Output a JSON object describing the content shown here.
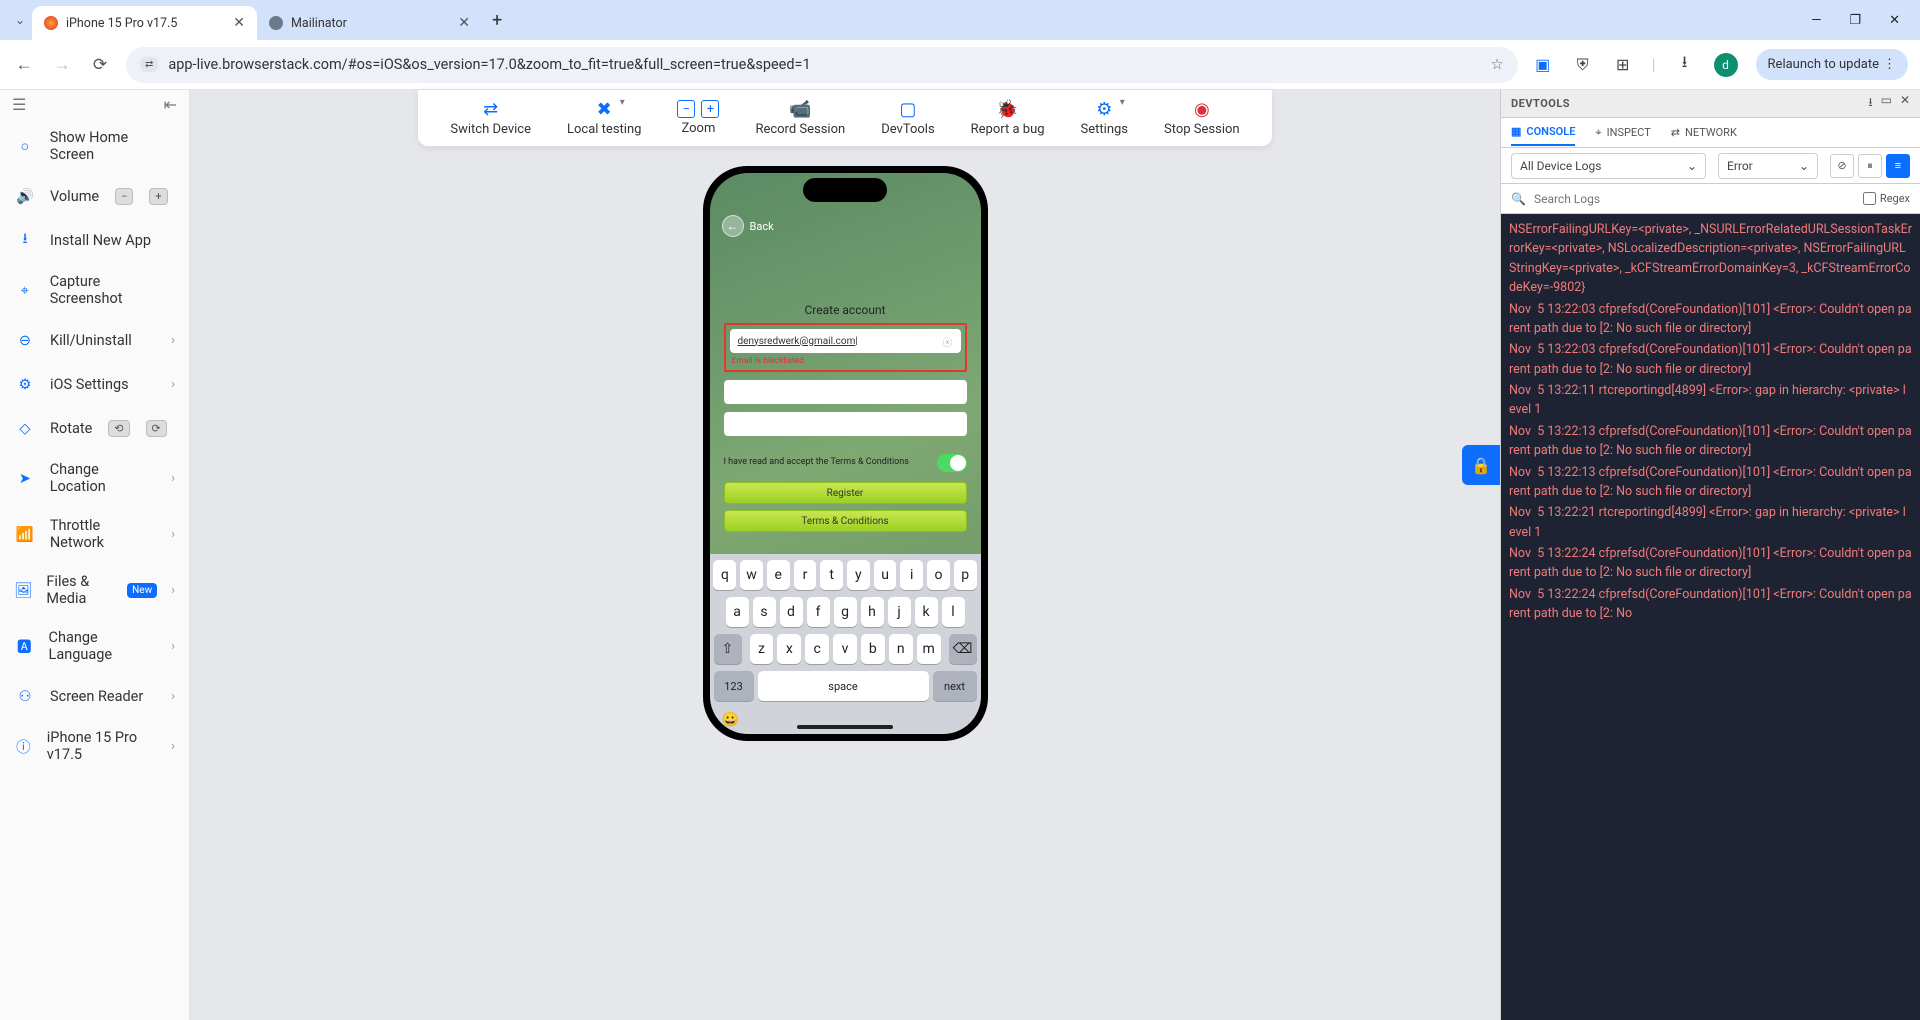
{
  "browser": {
    "tabs": [
      {
        "title": "iPhone 15 Pro v17.5",
        "active": true
      },
      {
        "title": "Mailinator",
        "active": false
      }
    ],
    "url": "app-live.browserstack.com/#os=iOS&os_version=17.0&zoom_to_fit=true&full_screen=true&speed=1",
    "avatar_initial": "d",
    "relaunch_label": "Relaunch to update"
  },
  "sidebar": {
    "items": [
      {
        "label": "Show Home Screen"
      },
      {
        "label": "Volume",
        "pills": [
          "−",
          "+"
        ]
      },
      {
        "label": "Install New App"
      },
      {
        "label": "Capture Screenshot"
      },
      {
        "label": "Kill/Uninstall",
        "chevron": true
      },
      {
        "label": "iOS Settings",
        "chevron": true
      },
      {
        "label": "Rotate",
        "pills": [
          "⟲",
          "⟳"
        ]
      },
      {
        "label": "Change Location",
        "chevron": true
      },
      {
        "label": "Throttle Network",
        "chevron": true
      },
      {
        "label": "Files & Media",
        "new": true,
        "chevron": true
      },
      {
        "label": "Change Language",
        "chevron": true
      },
      {
        "label": "Screen Reader",
        "chevron": true
      },
      {
        "label": "iPhone 15 Pro  v17.5",
        "chevron": true
      }
    ]
  },
  "toolbar": {
    "items": [
      {
        "label": "Switch Device"
      },
      {
        "label": "Local testing",
        "dropdown": true
      },
      {
        "label": "Zoom",
        "zoom": true
      },
      {
        "label": "Record Session"
      },
      {
        "label": "DevTools"
      },
      {
        "label": "Report a bug"
      },
      {
        "label": "Settings",
        "dropdown": true
      },
      {
        "label": "Stop Session",
        "stop": true
      }
    ]
  },
  "phone": {
    "back_label": "Back",
    "form_title": "Create account",
    "email_value": "denysredwerk@gmail.com",
    "email_error": "Email is blacklisted",
    "terms_text": "I have read and accept the Terms & Conditions",
    "register_label": "Register",
    "terms_btn_label": "Terms & Conditions",
    "keyboard": {
      "row1": [
        "q",
        "w",
        "e",
        "r",
        "t",
        "y",
        "u",
        "i",
        "o",
        "p"
      ],
      "row2": [
        "a",
        "s",
        "d",
        "f",
        "g",
        "h",
        "j",
        "k",
        "l"
      ],
      "row3": [
        "z",
        "x",
        "c",
        "v",
        "b",
        "n",
        "m"
      ],
      "num_label": "123",
      "space_label": "space",
      "next_label": "next"
    }
  },
  "devtools": {
    "title": "DEVTOOLS",
    "tabs": {
      "console": "CONSOLE",
      "inspect": "INSPECT",
      "network": "NETWORK"
    },
    "filter_device": "All Device Logs",
    "filter_level": "Error",
    "search_placeholder": "Search Logs",
    "regex_label": "Regex",
    "logs": [
      "NSErrorFailingURLKey=<private>, _NSURLErrorRelatedURLSessionTaskErrorKey=<private>, NSLocalizedDescription=<private>, NSErrorFailingURLStringKey=<private>, _kCFStreamErrorDomainKey=3, _kCFStreamErrorCodeKey=-9802}",
      "Nov  5 13:22:03 cfprefsd(CoreFoundation)[101] <Error>: Couldn't open parent path due to [2: No such file or directory]",
      "Nov  5 13:22:03 cfprefsd(CoreFoundation)[101] <Error>: Couldn't open parent path due to [2: No such file or directory]",
      "Nov  5 13:22:11 rtcreportingd[4899] <Error>: gap in hierarchy: <private> level 1",
      "Nov  5 13:22:13 cfprefsd(CoreFoundation)[101] <Error>: Couldn't open parent path due to [2: No such file or directory]",
      "Nov  5 13:22:13 cfprefsd(CoreFoundation)[101] <Error>: Couldn't open parent path due to [2: No such file or directory]",
      "Nov  5 13:22:21 rtcreportingd[4899] <Error>: gap in hierarchy: <private> level 1",
      "Nov  5 13:22:24 cfprefsd(CoreFoundation)[101] <Error>: Couldn't open parent path due to [2: No such file or directory]",
      "Nov  5 13:22:24 cfprefsd(CoreFoundation)[101] <Error>: Couldn't open parent path due to [2: No"
    ]
  }
}
